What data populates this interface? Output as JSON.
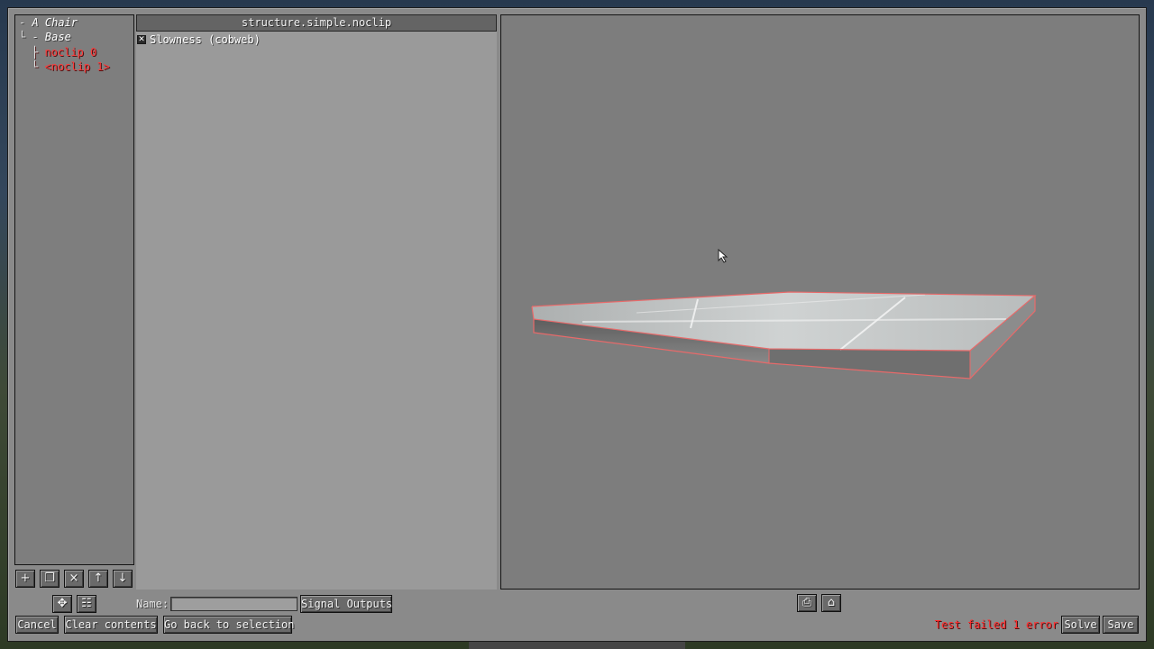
{
  "tree": {
    "items": [
      {
        "prefix": "- ",
        "label": "A Chair",
        "red": false
      },
      {
        "prefix": "└ - ",
        "label": "Base",
        "red": false
      },
      {
        "prefix": "├ ",
        "label": "noclip 0",
        "red": true
      },
      {
        "prefix": "└ ",
        "label": "<noclip 1>",
        "red": true
      }
    ],
    "buttons": {
      "add": "+",
      "duplicate": "❐",
      "delete": "×",
      "move_up": "↑",
      "move_down": "↓",
      "move_tool": "✥",
      "hierarchy_tool": "☷"
    }
  },
  "detail": {
    "header": "structure.simple.noclip",
    "checkbox_mark": "✕",
    "checkbox_label": "Slowness (cobweb)"
  },
  "bottom": {
    "name_label": "Name:",
    "name_value": "",
    "signal_outputs": "Signal Outputs",
    "cancel": "Cancel",
    "clear_contents": "Clear contents",
    "go_back": "Go back to selection",
    "status_text": "Test failed 1 error",
    "solve": "Solve",
    "save": "Save"
  },
  "preview": {
    "toolbar": {
      "camera": "⎙",
      "home": "⌂"
    },
    "colors": {
      "outline": "#e86a6a",
      "glass": "#d8dcdc"
    }
  }
}
